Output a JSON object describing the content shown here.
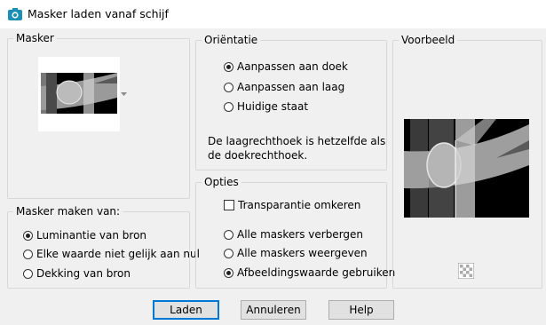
{
  "window": {
    "title": "Masker laden vanaf schijf"
  },
  "mask_group": {
    "label": "Masker"
  },
  "mask_source_group": {
    "label": "Masker maken van:",
    "options": [
      {
        "label": "Luminantie van bron",
        "checked": true
      },
      {
        "label": "Elke waarde niet gelijk aan nul",
        "checked": false
      },
      {
        "label": "Dekking van bron",
        "checked": false
      }
    ]
  },
  "orientation_group": {
    "label": "Oriëntatie",
    "options": [
      {
        "label": "Aanpassen aan doek",
        "checked": true
      },
      {
        "label": "Aanpassen aan laag",
        "checked": false
      },
      {
        "label": "Huidige staat",
        "checked": false
      }
    ],
    "info_line1": "De laagrechthoek is hetzelfde als",
    "info_line2": "de doekrechthoek."
  },
  "options_group": {
    "label": "Opties",
    "invert_transparency": {
      "label": "Transparantie omkeren",
      "checked": false
    },
    "options": [
      {
        "label": "Alle maskers verbergen",
        "checked": false
      },
      {
        "label": "Alle maskers weergeven",
        "checked": false
      },
      {
        "label": "Afbeeldingswaarde gebruiken",
        "checked": true
      }
    ]
  },
  "preview_group": {
    "label": "Voorbeeld"
  },
  "buttons": {
    "load": "Laden",
    "cancel": "Annuleren",
    "help": "Help"
  },
  "icons": {
    "app": "camera-icon",
    "dropdown": "chevron-down-icon",
    "transparency": "checkerboard-icon"
  },
  "colors": {
    "accent": "#0078d7",
    "app_icon": "#1a8fb8"
  }
}
